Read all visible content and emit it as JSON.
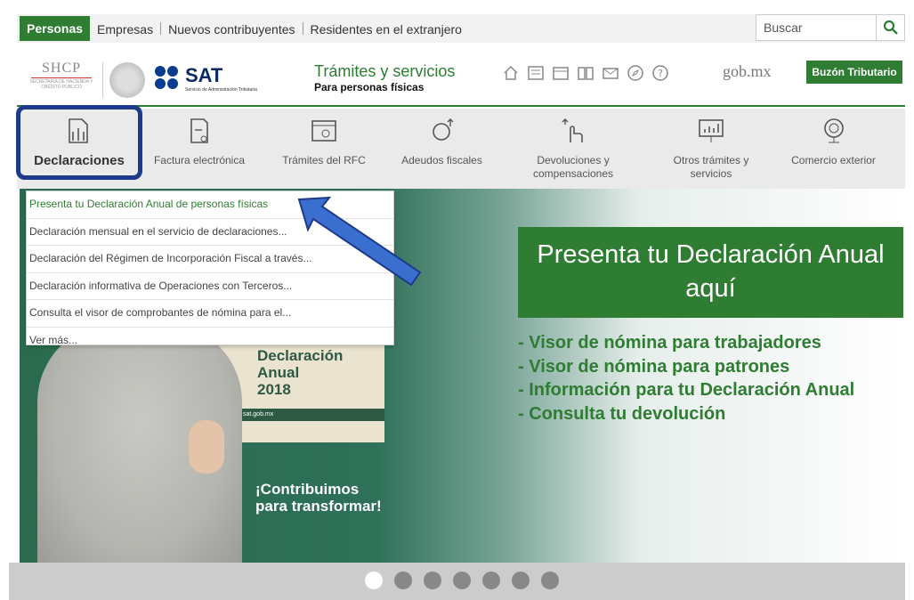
{
  "topnav": {
    "tabs": [
      "Personas",
      "Empresas",
      "Nuevos contribuyentes",
      "Residentes en el extranjero"
    ],
    "active_tab": "Personas",
    "search_placeholder": "Buscar"
  },
  "header": {
    "shcp_logo": "SHCP",
    "shcp_small": "SECRETARÍA DE HACIENDA Y CRÉDITO PÚBLICO",
    "sat_logo": "SAT",
    "sat_sub": "Servicio de Administración Tributaria",
    "tramites_title": "Trámites y servicios",
    "tramites_sub": "Para personas físicas",
    "icons": [
      "home-icon",
      "news-icon",
      "calendar-icon",
      "book-icon",
      "mail-icon",
      "compass-icon",
      "help-icon"
    ],
    "gobmx": "gob.mx",
    "buzon": "Buzón Tributario"
  },
  "categories": [
    {
      "label": "Declaraciones",
      "icon": "documents-icon"
    },
    {
      "label": "Factura electrónica",
      "icon": "invoice-icon"
    },
    {
      "label": "Trámites del RFC",
      "icon": "rfc-window-icon"
    },
    {
      "label": "Adeudos fiscales",
      "icon": "debts-icon"
    },
    {
      "label": "Devoluciones y compensaciones",
      "icon": "refund-hand-icon"
    },
    {
      "label": "Otros trámites y servicios",
      "icon": "chart-board-icon"
    },
    {
      "label": "Comercio exterior",
      "icon": "globe-money-icon"
    }
  ],
  "dropdown": [
    "Presenta tu Declaración Anual de personas físicas",
    "Declaración mensual en el servicio de declaraciones...",
    "Declaración del Régimen de Incorporación Fiscal a través...",
    "Declaración informativa de Operaciones con Terceros...",
    "Consulta el visor de comprobantes de nómina para el...",
    "Ver más..."
  ],
  "banner": {
    "poster_title": "Declaración\nAnual\n2018",
    "poster_url": "sat.gob.mx",
    "slogan": "¡Contribuimos\npara transformar!",
    "promo_title": "Presenta tu Declaración Anual aquí",
    "promo_items": [
      "- Visor de nómina para trabajadores",
      "- Visor de nómina para patrones",
      "- Información para tu Declaración Anual",
      "- Consulta tu devolución"
    ]
  },
  "carousel": {
    "total": 7,
    "active": 1
  },
  "colors": {
    "brand_green": "#2e7d32",
    "highlight_blue": "#1e3a8a",
    "arrow_blue": "#3a6fcf"
  }
}
